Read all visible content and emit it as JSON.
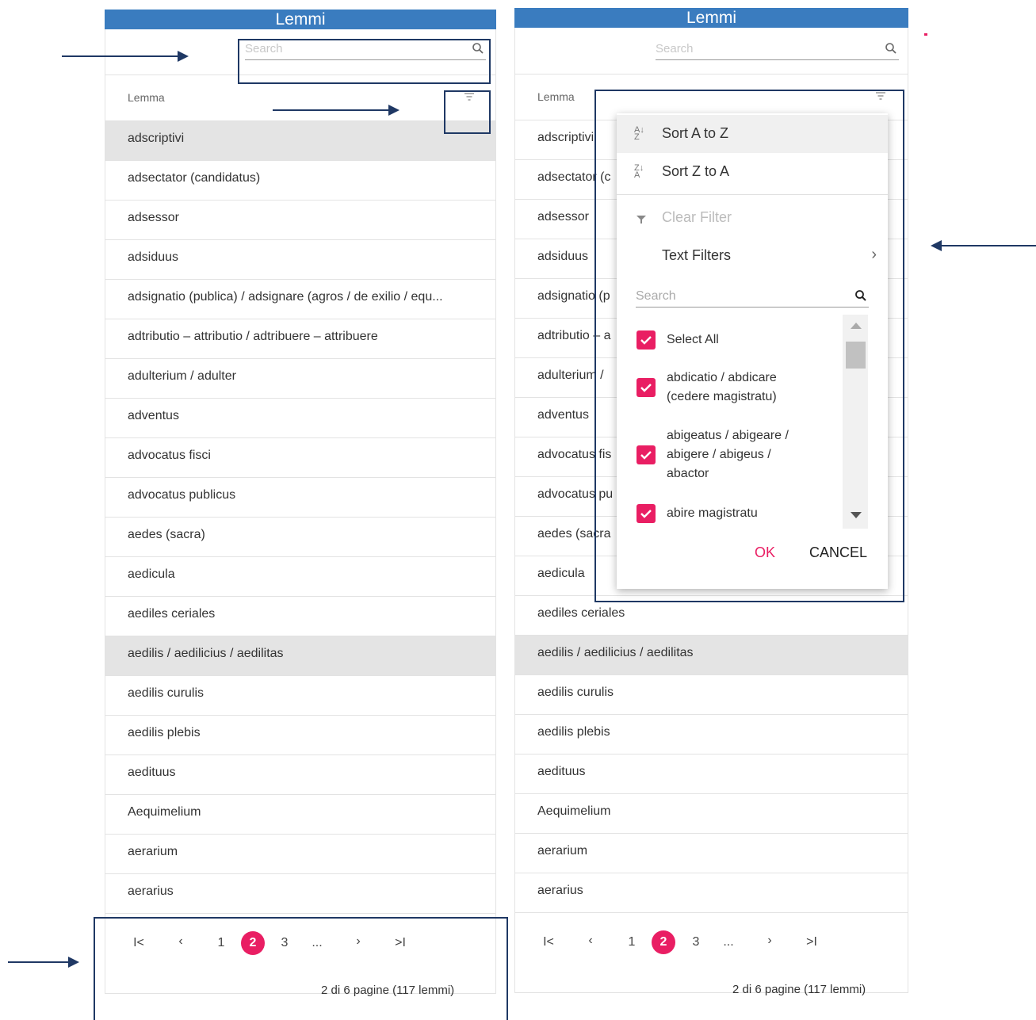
{
  "title": "Lemmi",
  "search": {
    "placeholder": "Search"
  },
  "grid": {
    "column_header": "Lemma",
    "rows": [
      "adscriptivi",
      "adsectator (candidatus)",
      "adsessor",
      "adsiduus",
      "adsignatio (publica) / adsignare (agros / de exilio / equ...",
      "adtributio – attributio / adtribuere – attribuere",
      "adulterium / adulter",
      "adventus",
      "advocatus fisci",
      "advocatus publicus",
      "aedes (sacra)",
      "aedicula",
      "aediles ceriales",
      "aedilis / aedilicius / aedilitas",
      "aedilis curulis",
      "aedilis plebis",
      "aedituus",
      "Aequimelium",
      "aerarium",
      "aerarius"
    ],
    "left_cut_rows": [
      "adscriptivi",
      "adsectator (c",
      "adsessor",
      "adsiduus",
      "adsignatio (p",
      "adtributio – a",
      "adulterium /",
      "adventus",
      "advocatus fis",
      "advocatus pu",
      "aedes (sacra",
      "aedicula"
    ]
  },
  "pager": {
    "first": "K",
    "prev": "‹",
    "pages": [
      "1",
      "2",
      "3"
    ],
    "ellipsis": "...",
    "next": "›",
    "last": "›I",
    "info": "2 di 6 pagine (117 lemmi)"
  },
  "filter_menu": {
    "sort_az": "Sort A to Z",
    "sort_za": "Sort Z to A",
    "clear_filter": "Clear Filter",
    "text_filters": "Text Filters",
    "search_placeholder": "Search",
    "items": [
      "Select All",
      "abdicatio / abdicare\n(cedere magistratu)",
      "abigeatus / abigeare /\nabigere / abigeus /\nabactor",
      "abire magistratu"
    ],
    "ok": "OK",
    "cancel": "CANCEL"
  },
  "colors": {
    "header_blue": "#3a7cbf",
    "accent_pink": "#e91e63",
    "annotation_navy": "#1f3864"
  }
}
